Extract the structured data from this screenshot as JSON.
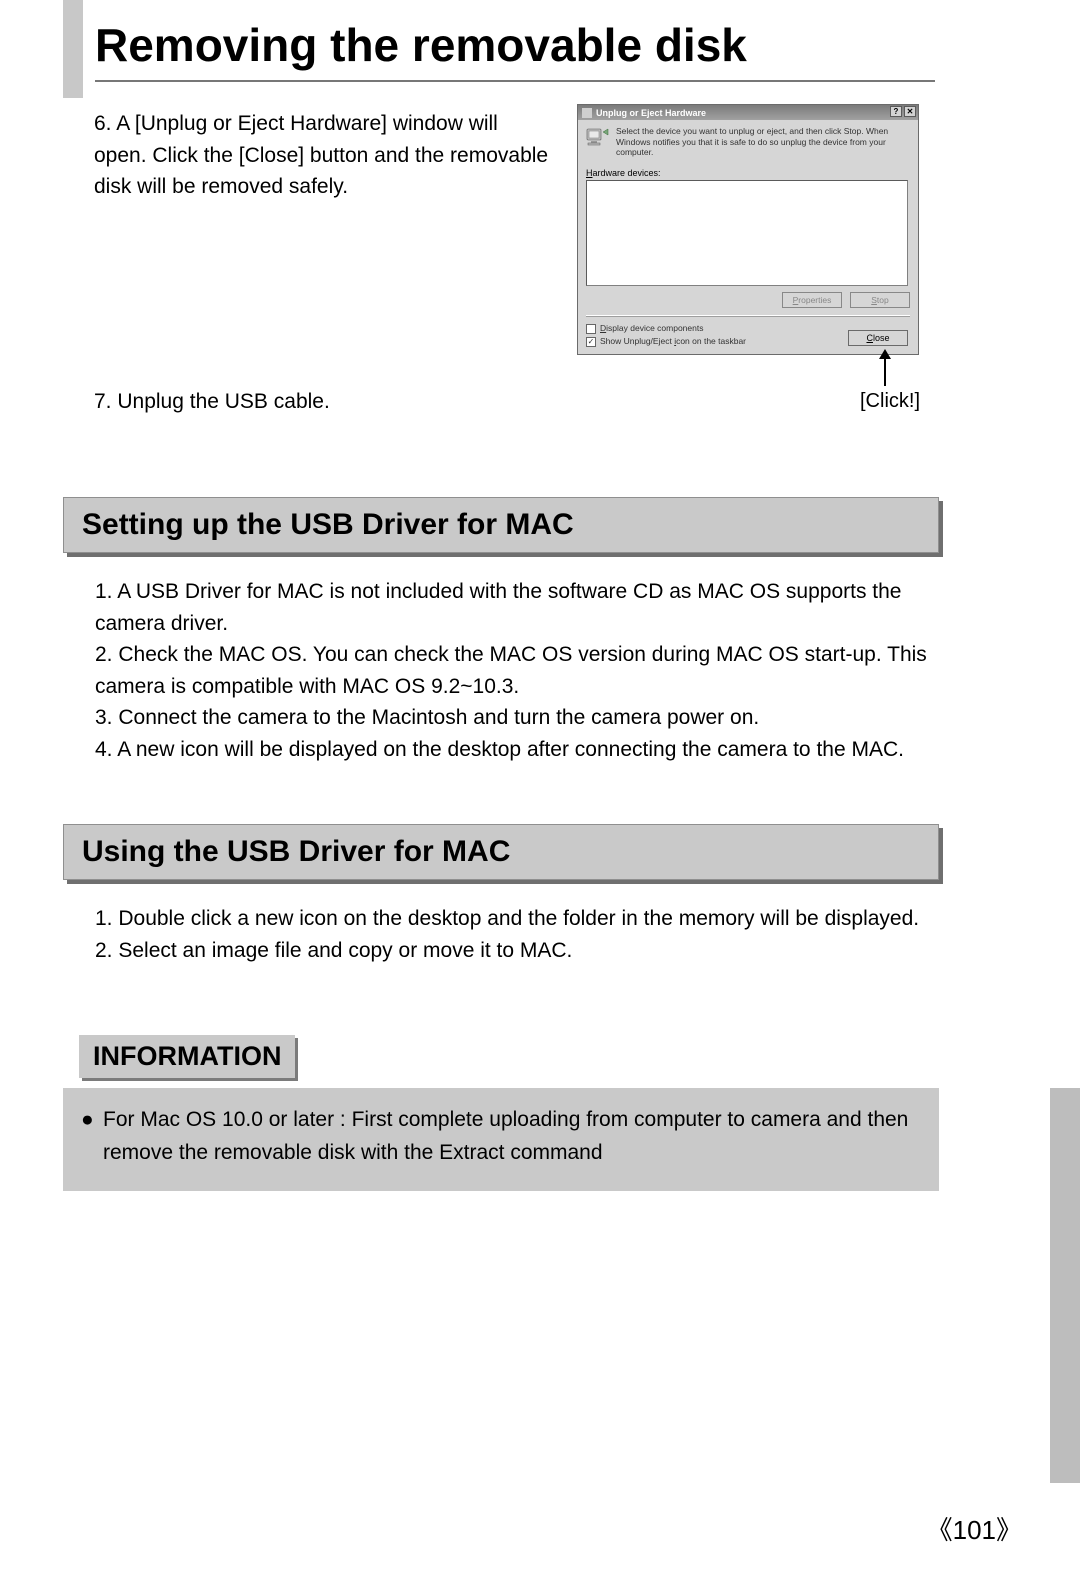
{
  "main_title": "Removing the removable disk",
  "steps": {
    "s6": "6. A [Unplug or Eject Hardware] window will open. Click the [Close] button and the removable disk will be removed safely.",
    "s7": "7. Unplug the USB cable."
  },
  "dialog": {
    "title": "Unplug or Eject Hardware",
    "help_glyph": "?",
    "close_glyph": "✕",
    "instruction": "Select the device you want to unplug or eject, and then click Stop. When Windows notifies you that it is safe to do so unplug the device from your computer.",
    "hardware_label_pre": "H",
    "hardware_label_rest": "ardware devices:",
    "btn_properties_pre": "P",
    "btn_properties_rest": "roperties",
    "btn_stop_pre": "S",
    "btn_stop_rest": "top",
    "chk_components_pre": "D",
    "chk_components_rest": "isplay device components",
    "chk_taskbar": "Show Unplug/Eject ",
    "chk_taskbar_u": "i",
    "chk_taskbar_rest": "con on the taskbar",
    "chk_taskbar_checked": "✓",
    "close_btn_pre": "C",
    "close_btn_rest": "lose"
  },
  "click_label": "[Click!]",
  "sections": {
    "setting_title": "Setting up the USB Driver for MAC",
    "setting_body": {
      "i1": "1. A USB Driver for MAC is not included with the software CD as MAC OS supports the camera driver.",
      "i2": "2. Check the MAC OS. You can check the MAC OS version during MAC OS start-up. This camera is compatible with MAC OS 9.2~10.3.",
      "i3": "3. Connect the camera to the Macintosh and turn the camera power on.",
      "i4": "4. A new icon will be displayed on the desktop after connecting the camera to the MAC."
    },
    "using_title": "Using the USB Driver for MAC",
    "using_body": {
      "i1": "1. Double click a new icon on the desktop and the folder in the memory will be displayed.",
      "i2": "2. Select an image file and copy or move it to MAC."
    }
  },
  "info": {
    "header": "INFORMATION",
    "bullet": "●",
    "line1": "For Mac OS 10.0 or later : First complete uploading from computer to camera and then",
    "line2": "remove the removable disk with the Extract command"
  },
  "page_number": "《101》"
}
